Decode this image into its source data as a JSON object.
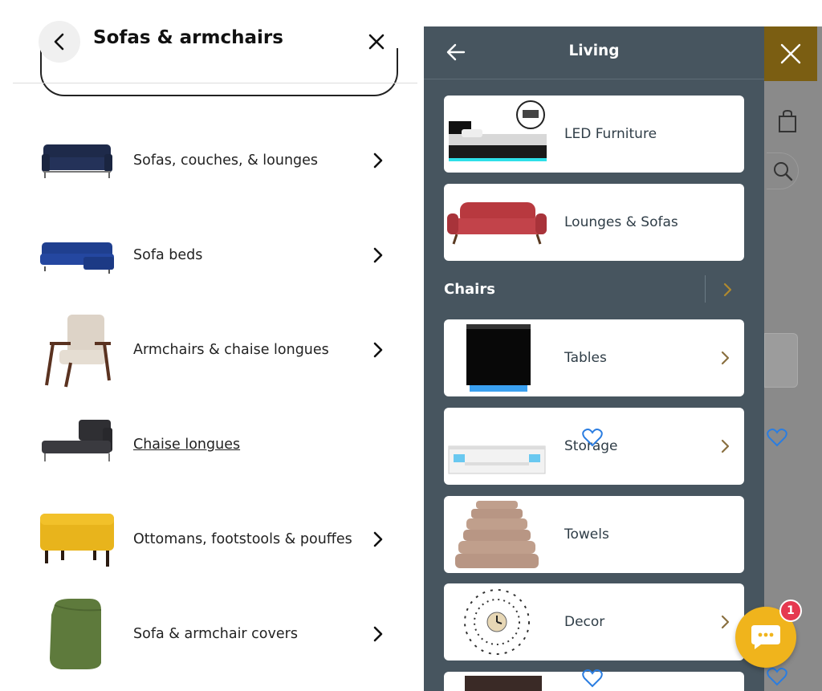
{
  "left_panel": {
    "title": "Sofas & armchairs",
    "categories": [
      {
        "label": "Sofas, couches, & lounges",
        "icon": "sofa-navy"
      },
      {
        "label": "Sofa beds",
        "icon": "sofa-bed-blue"
      },
      {
        "label": "Armchairs & chaise longues",
        "icon": "armchair-beige"
      },
      {
        "label": "Chaise longues",
        "icon": "chaise-grey"
      },
      {
        "label": "Ottomans, footstools & pouffes",
        "icon": "ottoman-yellow"
      },
      {
        "label": "Sofa & armchair covers",
        "icon": "cover-green"
      }
    ]
  },
  "drawer": {
    "title": "Living",
    "items": [
      {
        "label": "LED Furniture",
        "has_chevron": false
      },
      {
        "label": "Lounges & Sofas",
        "has_chevron": false
      }
    ],
    "section": {
      "label": "Chairs"
    },
    "section_items": [
      {
        "label": "Tables",
        "has_chevron": true
      },
      {
        "label": "Storage",
        "has_chevron": true
      },
      {
        "label": "Towels",
        "has_chevron": false
      },
      {
        "label": "Decor",
        "has_chevron": true
      }
    ]
  },
  "chat": {
    "badge_count": "1"
  },
  "colors": {
    "drawer_bg": "#47555f",
    "accent_gold": "#b08a2e",
    "chat_yellow": "#f0b41c",
    "badge_red": "#e53950",
    "heart_blue": "#2a7de1"
  }
}
